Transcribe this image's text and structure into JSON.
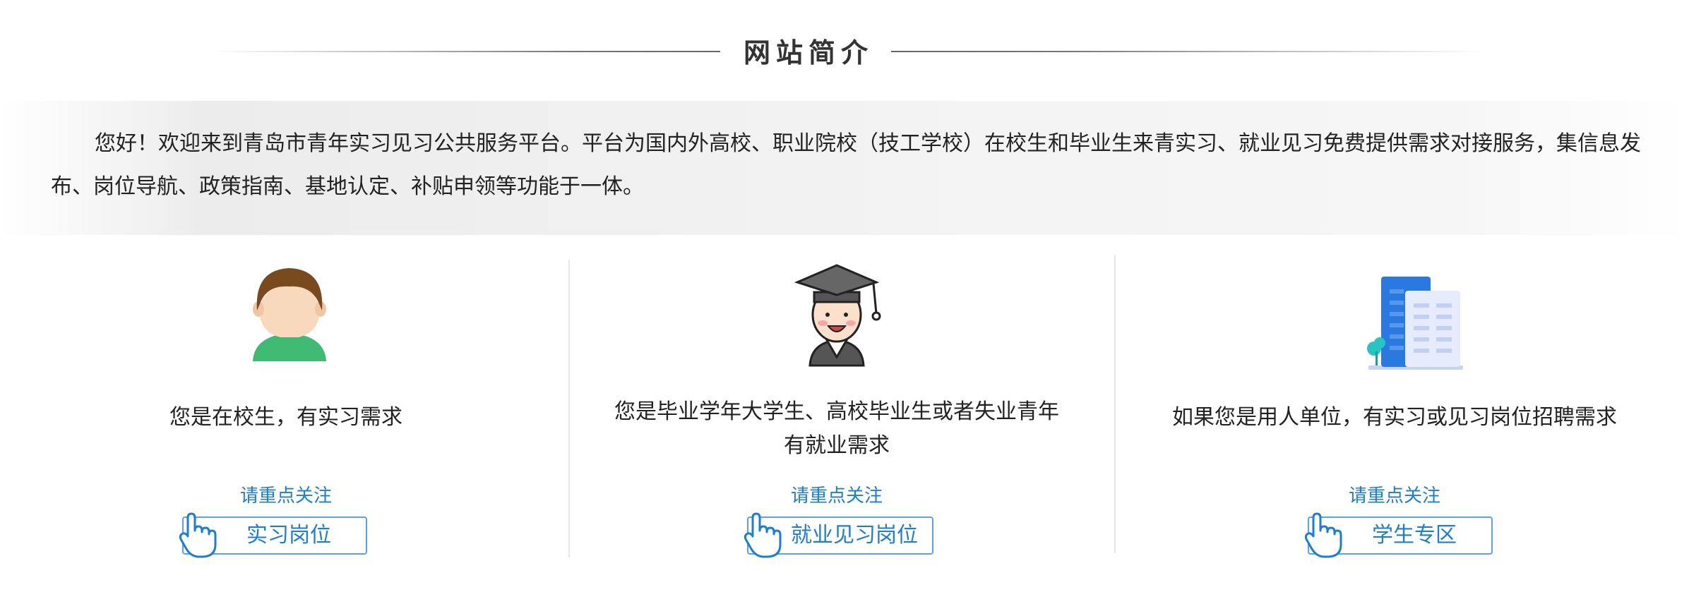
{
  "section": {
    "title": "网站简介",
    "intro": "您好！欢迎来到青岛市青年实习见习公共服务平台。平台为国内外高校、职业院校（技工学校）在校生和毕业生来青实习、就业见习免费提供需求对接服务，集信息发布、岗位导航、政策指南、基地认定、补贴申领等功能于一体。"
  },
  "cards": [
    {
      "icon": "student-avatar-icon",
      "description": "您是在校生，有实习需求",
      "follow_label": "请重点关注",
      "button_label": "实习岗位"
    },
    {
      "icon": "graduate-avatar-icon",
      "description_line1": "您是毕业学年大学生、高校毕业生或者失业青年",
      "description_line2": "有就业需求",
      "follow_label": "请重点关注",
      "button_label": "就业见习岗位"
    },
    {
      "icon": "office-building-icon",
      "description": "如果您是用人单位，有实习或见习岗位招聘需求",
      "follow_label": "请重点关注",
      "button_label": "学生专区"
    }
  ],
  "colors": {
    "accent_blue": "#1a7fd4",
    "button_border": "#5aa3e2",
    "title_text": "#333333"
  }
}
